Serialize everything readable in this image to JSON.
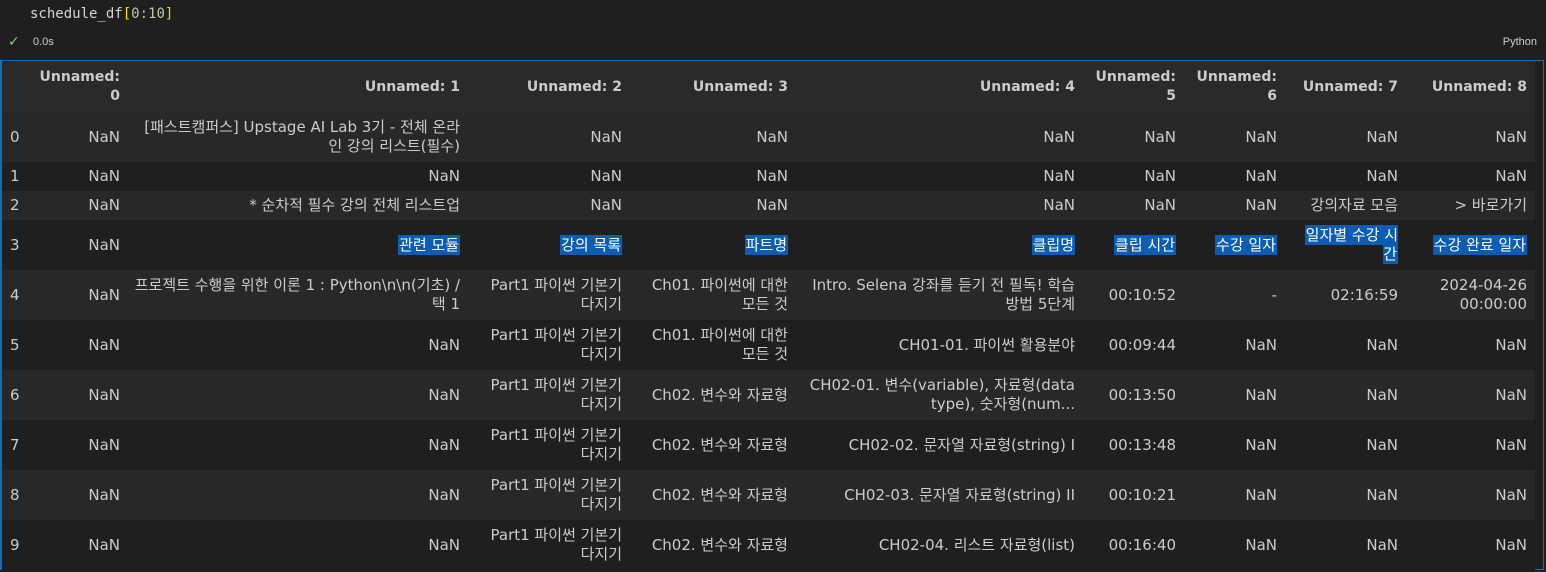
{
  "cell": {
    "code": "schedule_df[0:10]",
    "code_parts": {
      "name": "schedule_df",
      "open": "[",
      "range": "0:10",
      "close": "]"
    },
    "status_time": "0.0s",
    "language": "Python"
  },
  "table": {
    "columns": [
      "",
      "Unnamed: 0",
      "Unnamed: 1",
      "Unnamed: 2",
      "Unnamed: 3",
      "Unnamed: 4",
      "Unnamed: 5",
      "Unnamed: 6",
      "Unnamed: 7",
      "Unnamed: 8"
    ],
    "rows": [
      [
        "0",
        "NaN",
        "[패스트캠퍼스] Upstage AI Lab 3기 - 전체 온라인 강의 리스트(필수)",
        "NaN",
        "NaN",
        "NaN",
        "NaN",
        "NaN",
        "NaN",
        "NaN"
      ],
      [
        "1",
        "NaN",
        "NaN",
        "NaN",
        "NaN",
        "NaN",
        "NaN",
        "NaN",
        "NaN",
        "NaN"
      ],
      [
        "2",
        "NaN",
        "* 순차적 필수 강의 전체 리스트업",
        "NaN",
        "NaN",
        "NaN",
        "NaN",
        "NaN",
        "강의자료 모음",
        "> 바로가기"
      ],
      [
        "3",
        "NaN",
        "관련 모듈",
        "강의 목록",
        "파트명",
        "클립명",
        "클립 시간",
        "수강 일자",
        "일자별 수강 시간",
        "수강 완료 일자"
      ],
      [
        "4",
        "NaN",
        "프로젝트 수행을 위한 이론 1 : Python\\n\\n(기초) / 택 1",
        "Part1 파이썬 기본기 다지기",
        "Ch01. 파이썬에 대한 모든 것",
        "Intro. Selena 강좌를 듣기 전 필독! 학습 방법 5단계",
        "00:10:52",
        "-",
        "02:16:59",
        "2024-04-26 00:00:00"
      ],
      [
        "5",
        "NaN",
        "NaN",
        "Part1 파이썬 기본기 다지기",
        "Ch01. 파이썬에 대한 모든 것",
        "CH01-01. 파이썬 활용분야",
        "00:09:44",
        "NaN",
        "NaN",
        "NaN"
      ],
      [
        "6",
        "NaN",
        "NaN",
        "Part1 파이썬 기본기 다지기",
        "Ch02. 변수와 자료형",
        "CH02-01. 변수(variable), 자료형(data type), 숫자형(num...",
        "00:13:50",
        "NaN",
        "NaN",
        "NaN"
      ],
      [
        "7",
        "NaN",
        "NaN",
        "Part1 파이썬 기본기 다지기",
        "Ch02. 변수와 자료형",
        "CH02-02. 문자열 자료형(string) I",
        "00:13:48",
        "NaN",
        "NaN",
        "NaN"
      ],
      [
        "8",
        "NaN",
        "NaN",
        "Part1 파이썬 기본기 다지기",
        "Ch02. 변수와 자료형",
        "CH02-03. 문자열 자료형(string) II",
        "00:10:21",
        "NaN",
        "NaN",
        "NaN"
      ],
      [
        "9",
        "NaN",
        "NaN",
        "Part1 파이썬 기본기 다지기",
        "Ch02. 변수와 자료형",
        "CH02-04. 리스트 자료형(list)",
        "00:16:40",
        "NaN",
        "NaN",
        "NaN"
      ]
    ],
    "highlighted_row": 3
  },
  "colors": {
    "background": "#1f1f1f",
    "selection": "#0b5cb3",
    "success": "#89d185",
    "border": "#0e6eb8"
  }
}
